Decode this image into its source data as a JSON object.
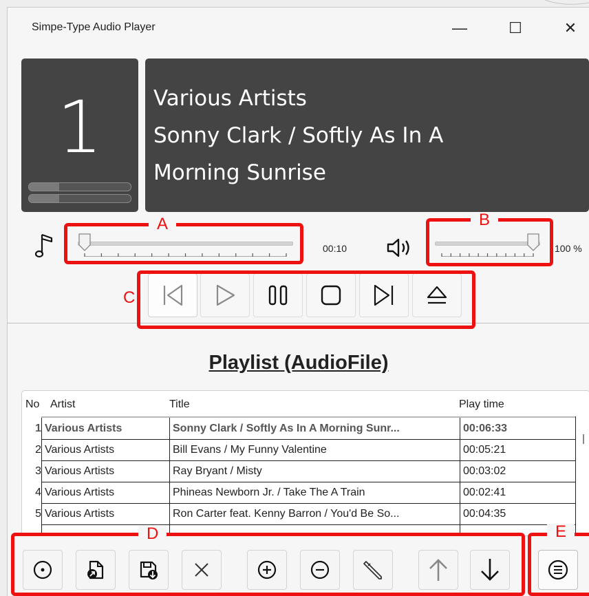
{
  "window": {
    "title": "Simpe-Type Audio Player",
    "minimize_glyph": "—",
    "maximize_glyph": "☐",
    "close_glyph": "✕"
  },
  "now_playing": {
    "track_number": "1",
    "artist": "Various Artists",
    "title_line1": "Sonny Clark / Softly As In A",
    "title_line2": "Morning Sunrise",
    "level_left": 0.3,
    "level_right": 0.3
  },
  "seek": {
    "position_fraction": 0.0,
    "time": "00:10"
  },
  "volume": {
    "level_fraction": 1.0,
    "label": "100 %"
  },
  "annotations": {
    "A": "A",
    "B": "B",
    "C": "C",
    "D": "D",
    "E": "E",
    "color": "#ee1111"
  },
  "transport": [
    {
      "name": "previous-button",
      "icon": "skip-previous-icon"
    },
    {
      "name": "play-button",
      "icon": "play-icon"
    },
    {
      "name": "pause-button",
      "icon": "pause-icon"
    },
    {
      "name": "stop-button",
      "icon": "stop-icon"
    },
    {
      "name": "next-button",
      "icon": "skip-next-icon"
    },
    {
      "name": "eject-button",
      "icon": "eject-icon"
    }
  ],
  "playlist": {
    "heading": "Playlist (AudioFile)",
    "columns": [
      "No",
      "Artist",
      "Title",
      "Play time"
    ],
    "rows": [
      {
        "no": "1",
        "artist": "Various Artists",
        "title": "Sonny Clark / Softly As In A Morning Sunr...",
        "time": "00:06:33",
        "playing": true
      },
      {
        "no": "2",
        "artist": "Various Artists",
        "title": "Bill Evans / My Funny Valentine",
        "time": "00:05:21"
      },
      {
        "no": "3",
        "artist": "Various Artists",
        "title": "Ray Bryant / Misty",
        "time": "00:03:02"
      },
      {
        "no": "4",
        "artist": "Various Artists",
        "title": "Phineas Newborn Jr. / Take The A Train",
        "time": "00:02:41"
      },
      {
        "no": "5",
        "artist": "Various Artists",
        "title": "Ron Carter feat. Kenny Barron / You'd Be So...",
        "time": "00:04:35"
      }
    ]
  },
  "bottom_toolbar": [
    {
      "name": "open-disc-button",
      "icon": "disc-icon"
    },
    {
      "name": "open-file-button",
      "icon": "file-open-icon"
    },
    {
      "name": "save-playlist-button",
      "icon": "save-icon"
    },
    {
      "name": "clear-button",
      "icon": "close-icon"
    },
    {
      "name": "add-button",
      "icon": "plus-circle-icon"
    },
    {
      "name": "remove-button",
      "icon": "minus-circle-icon"
    },
    {
      "name": "edit-button",
      "icon": "pencil-icon"
    },
    {
      "name": "move-up-button",
      "icon": "arrow-up-icon"
    },
    {
      "name": "move-down-button",
      "icon": "arrow-down-icon"
    },
    {
      "name": "menu-button",
      "icon": "menu-icon"
    }
  ]
}
